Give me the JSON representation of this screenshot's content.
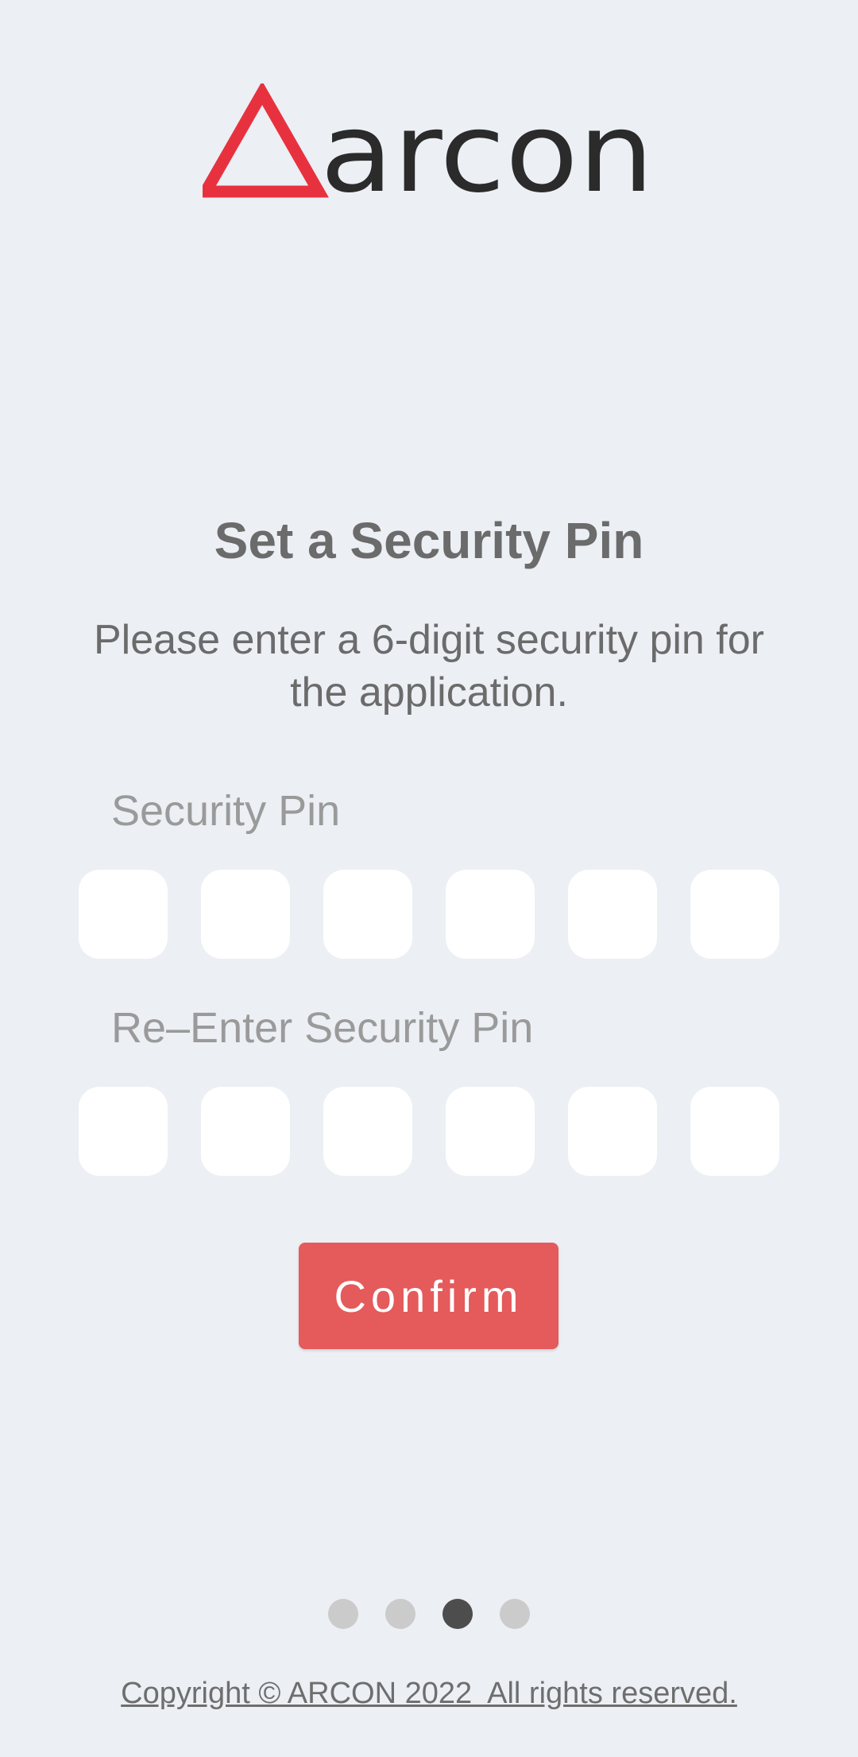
{
  "logo": {
    "text": "arcon",
    "icon": "triangle-icon",
    "accent_color": "#e8313f",
    "text_color": "#2b2b2b"
  },
  "title": "Set a Security Pin",
  "subtitle": "Please enter a 6-digit security pin for the application.",
  "security_pin": {
    "label": "Security Pin",
    "digits": [
      "",
      "",
      "",
      "",
      "",
      ""
    ]
  },
  "reenter_pin": {
    "label": "Re–Enter Security Pin",
    "digits": [
      "",
      "",
      "",
      "",
      "",
      ""
    ]
  },
  "confirm_button": {
    "label": "Confirm",
    "color": "#e55a5b"
  },
  "pagination": {
    "total": 4,
    "active_index": 2
  },
  "footer": {
    "copyright": "Copyright © ARCON 2022  All rights reserved."
  }
}
